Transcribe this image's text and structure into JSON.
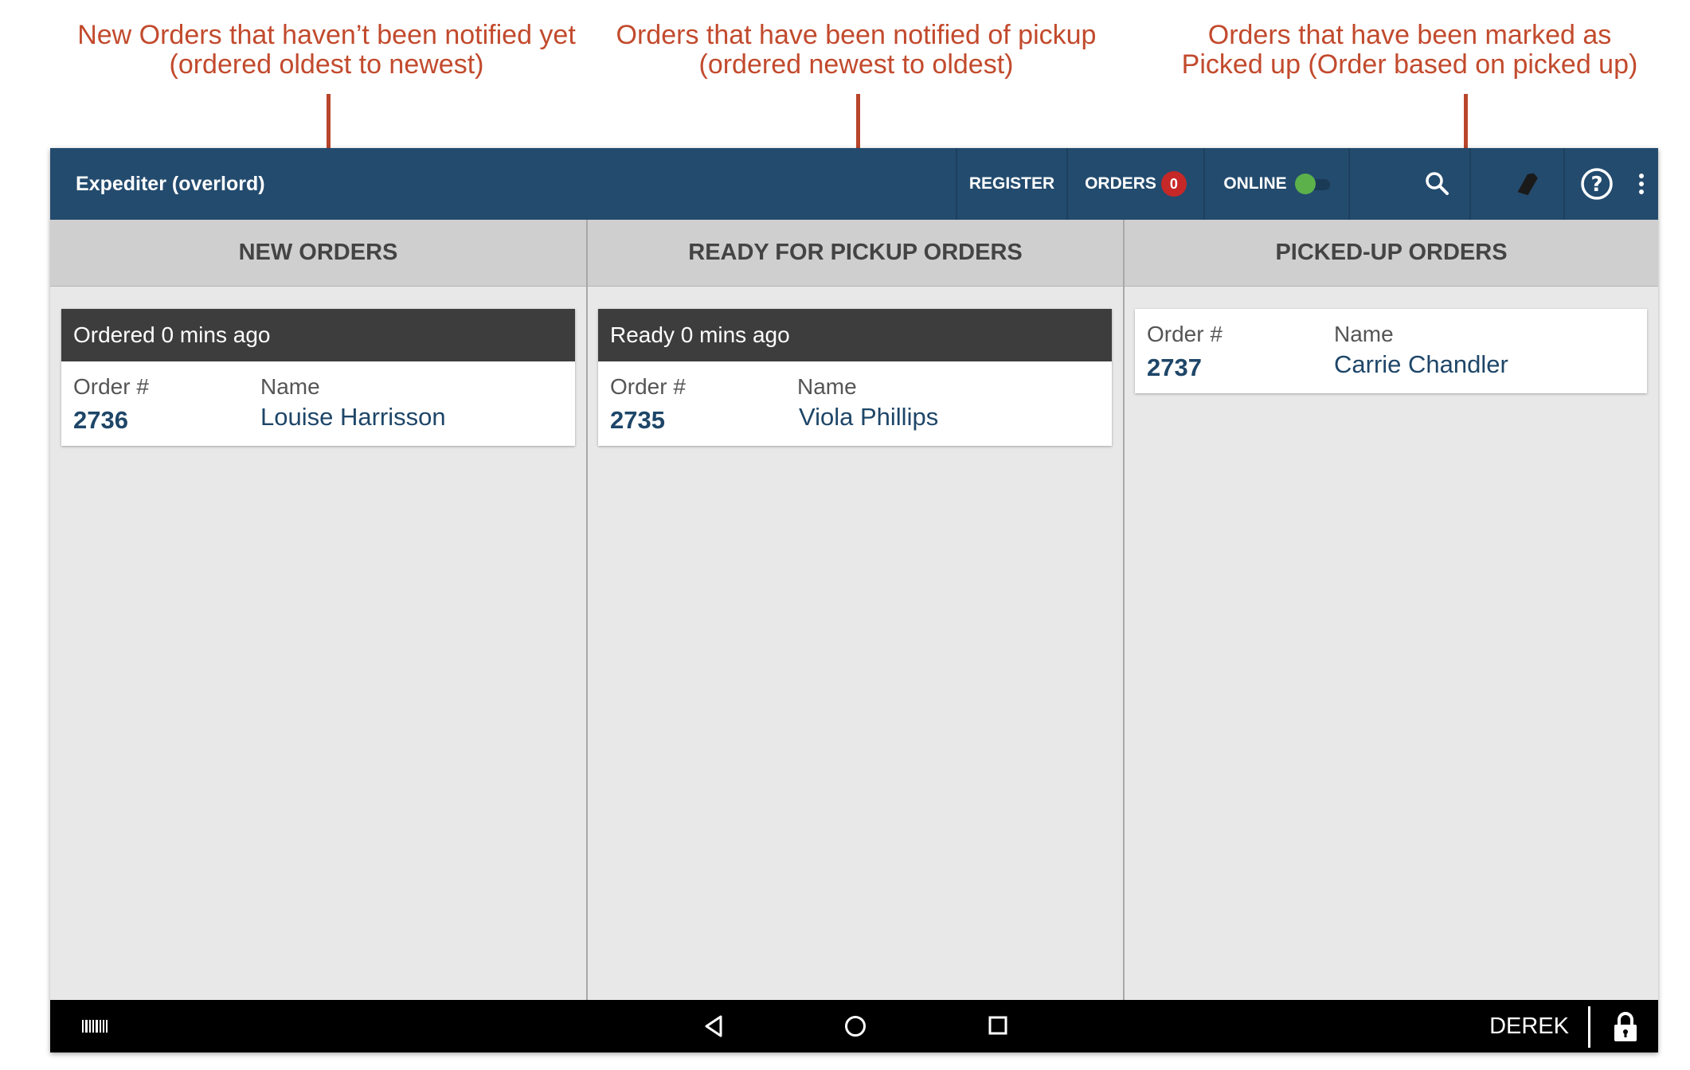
{
  "annotations": [
    {
      "line1": "New Orders that haven’t been notified yet",
      "line2": "(ordered oldest to newest)"
    },
    {
      "line1": "Orders that have been notified of pickup",
      "line2": "(ordered newest to oldest)"
    },
    {
      "line1": "Orders that have been marked as",
      "line2": "Picked up (Order based on picked up)"
    }
  ],
  "colors": {
    "annotation": "#c24a2d",
    "appbar": "#234b6e",
    "badge": "#c62828",
    "toggle_on": "#5cb14b",
    "card_header": "#3d3d3d",
    "value_text": "#1e4668"
  },
  "appbar": {
    "title": "Expediter (overlord)",
    "register_label": "REGISTER",
    "orders_label": "ORDERS",
    "orders_count": "0",
    "online_label": "ONLINE",
    "online_enabled": true,
    "icons": [
      "search-icon",
      "tag-icon",
      "help-icon",
      "more-vert-icon"
    ]
  },
  "columns": [
    {
      "header": "NEW ORDERS",
      "cards": [
        {
          "status": "Ordered 0 mins ago",
          "order_label": "Order #",
          "order_number": "2736",
          "name_label": "Name",
          "name": "Louise Harrisson"
        }
      ]
    },
    {
      "header": "READY FOR PICKUP ORDERS",
      "cards": [
        {
          "status": "Ready 0 mins ago",
          "order_label": "Order #",
          "order_number": "2735",
          "name_label": "Name",
          "name": "Viola Phillips"
        }
      ]
    },
    {
      "header": "PICKED-UP ORDERS",
      "cards": [
        {
          "order_label": "Order #",
          "order_number": "2737",
          "name_label": "Name",
          "name": "Carrie Chandler"
        }
      ]
    }
  ],
  "system_bar": {
    "user": "DEREK",
    "icons": [
      "barcode-icon",
      "back-icon",
      "home-icon",
      "recents-icon",
      "lock-icon"
    ]
  }
}
